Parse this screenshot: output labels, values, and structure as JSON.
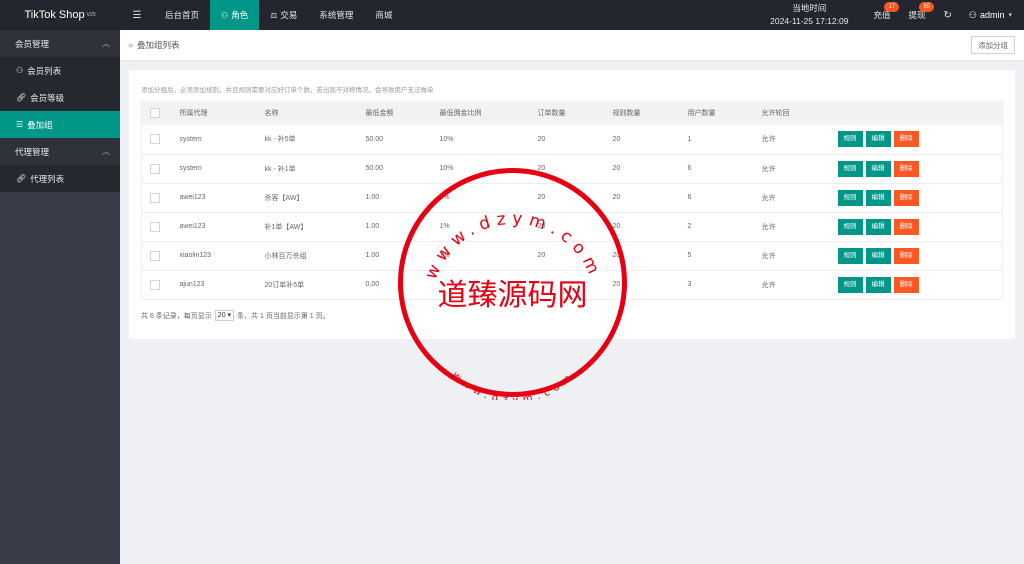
{
  "brand": {
    "title": "TikTok Shop",
    "version": "V20"
  },
  "nav": [
    {
      "label": "后台首页",
      "icon": ""
    },
    {
      "label": "角色",
      "icon": "user-icon"
    },
    {
      "label": "交易",
      "icon": "scale-icon"
    },
    {
      "label": "系统管理",
      "icon": ""
    },
    {
      "label": "商城",
      "icon": ""
    }
  ],
  "clock": {
    "label": "当地时间",
    "value": "2024-11-25 17:12:09"
  },
  "topRight": {
    "recharge": {
      "label": "充值",
      "badge": "17"
    },
    "withdraw": {
      "label": "提现",
      "badge": "65"
    },
    "user": "admin"
  },
  "sidebar": {
    "group1": "会员管理",
    "items1": [
      "会员列表",
      "会员等级",
      "叠加组"
    ],
    "group2": "代理管理",
    "items2": [
      "代理列表"
    ]
  },
  "breadcrumb": "叠加组列表",
  "addGroup": "添加分组",
  "tip": "添加分组后，必须添加规则，并且规则需要对应好订单个数，若出现不对称情况，会导致用户无法做单",
  "columns": [
    "所属代理",
    "名称",
    "最低金额",
    "最低佣金比例",
    "订单数量",
    "规则数量",
    "用户数量",
    "允许轮回"
  ],
  "rows": [
    [
      "system",
      "kk - 补5单",
      "50.00",
      "10%",
      "20",
      "20",
      "1",
      "允许"
    ],
    [
      "system",
      "kk - 补1单",
      "50.00",
      "10%",
      "20",
      "20",
      "6",
      "允许"
    ],
    [
      "awei123",
      "杀客【AW】",
      "1.00",
      "1%",
      "20",
      "20",
      "6",
      "允许"
    ],
    [
      "awei123",
      "补1单【AW】",
      "1.00",
      "1%",
      "20",
      "20",
      "2",
      "允许"
    ],
    [
      "xiaolin123",
      "小林百万杀组",
      "1.00",
      "1%",
      "20",
      "20",
      "5",
      "允许"
    ],
    [
      "ajun123",
      "20订单补5单",
      "0.00",
      "",
      "",
      "20",
      "3",
      "允许"
    ]
  ],
  "actions": {
    "rule": "规则",
    "edit": "编辑",
    "delete": "删除"
  },
  "pager": {
    "prefix": "共 6 条记录，每页显示",
    "pageSize": "20",
    "suffix": "条，共 1 页当前显示第 1 页。"
  },
  "watermark": {
    "center": "道臻源码网",
    "top": "www.dzym.com",
    "bottom": "www.dzym.com",
    "color": "#e60012"
  }
}
